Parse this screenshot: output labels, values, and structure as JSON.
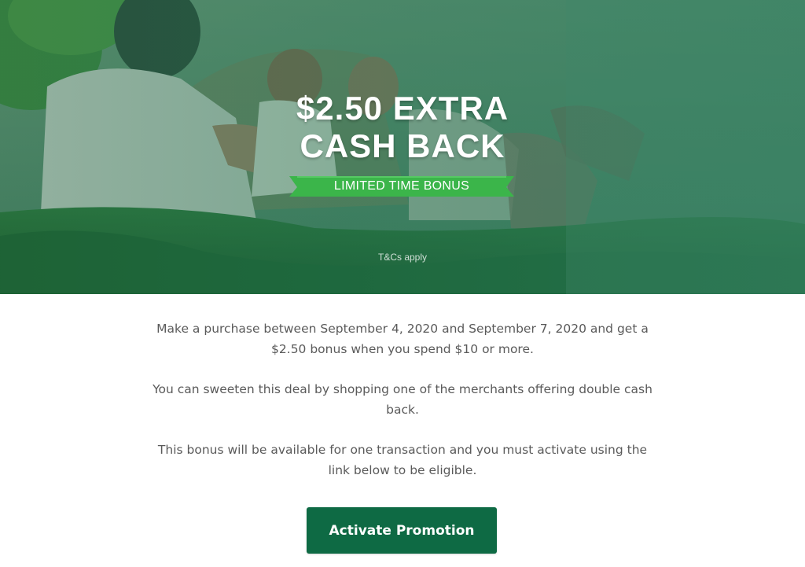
{
  "hero": {
    "headline_line1": "$2.50 EXTRA",
    "headline_line2": "CASH BACK",
    "ribbon": "LIMITED TIME BONUS",
    "tcs": "T&Cs apply"
  },
  "content": {
    "paragraph1": "Make a purchase between September 4, 2020 and September 7, 2020 and get a $2.50 bonus when you spend $10 or more.",
    "paragraph2": "You can sweeten this deal by shopping one of the merchants offering double cash back.",
    "paragraph3": "This bonus will be available for one transaction and you must activate using the link below to be eligible."
  },
  "cta": {
    "label": "Activate Promotion"
  },
  "colors": {
    "hero_tint": "#3a7a62",
    "ribbon_green": "#3bb54a",
    "button_green": "#0e6a44",
    "body_text": "#5a5a5a"
  }
}
